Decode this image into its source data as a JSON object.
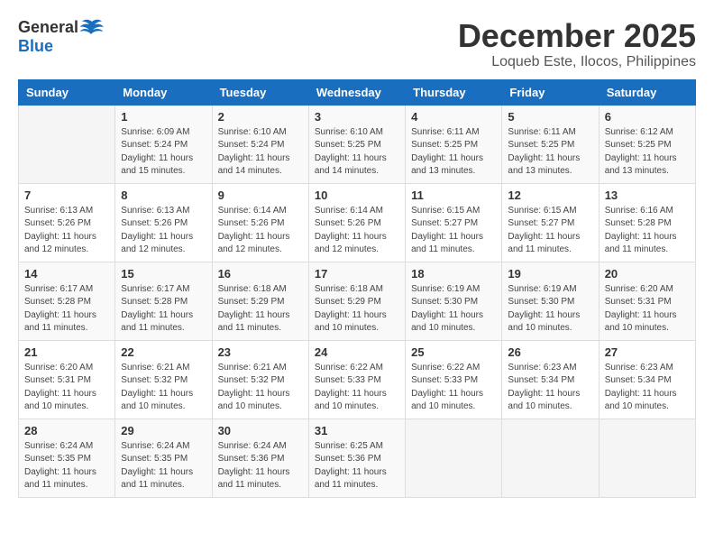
{
  "header": {
    "logo_general": "General",
    "logo_blue": "Blue",
    "month": "December 2025",
    "location": "Loqueb Este, Ilocos, Philippines"
  },
  "weekdays": [
    "Sunday",
    "Monday",
    "Tuesday",
    "Wednesday",
    "Thursday",
    "Friday",
    "Saturday"
  ],
  "weeks": [
    [
      {
        "day": "",
        "sunrise": "",
        "sunset": "",
        "daylight": ""
      },
      {
        "day": "1",
        "sunrise": "Sunrise: 6:09 AM",
        "sunset": "Sunset: 5:24 PM",
        "daylight": "Daylight: 11 hours and 15 minutes."
      },
      {
        "day": "2",
        "sunrise": "Sunrise: 6:10 AM",
        "sunset": "Sunset: 5:24 PM",
        "daylight": "Daylight: 11 hours and 14 minutes."
      },
      {
        "day": "3",
        "sunrise": "Sunrise: 6:10 AM",
        "sunset": "Sunset: 5:25 PM",
        "daylight": "Daylight: 11 hours and 14 minutes."
      },
      {
        "day": "4",
        "sunrise": "Sunrise: 6:11 AM",
        "sunset": "Sunset: 5:25 PM",
        "daylight": "Daylight: 11 hours and 13 minutes."
      },
      {
        "day": "5",
        "sunrise": "Sunrise: 6:11 AM",
        "sunset": "Sunset: 5:25 PM",
        "daylight": "Daylight: 11 hours and 13 minutes."
      },
      {
        "day": "6",
        "sunrise": "Sunrise: 6:12 AM",
        "sunset": "Sunset: 5:25 PM",
        "daylight": "Daylight: 11 hours and 13 minutes."
      }
    ],
    [
      {
        "day": "7",
        "sunrise": "Sunrise: 6:13 AM",
        "sunset": "Sunset: 5:26 PM",
        "daylight": "Daylight: 11 hours and 12 minutes."
      },
      {
        "day": "8",
        "sunrise": "Sunrise: 6:13 AM",
        "sunset": "Sunset: 5:26 PM",
        "daylight": "Daylight: 11 hours and 12 minutes."
      },
      {
        "day": "9",
        "sunrise": "Sunrise: 6:14 AM",
        "sunset": "Sunset: 5:26 PM",
        "daylight": "Daylight: 11 hours and 12 minutes."
      },
      {
        "day": "10",
        "sunrise": "Sunrise: 6:14 AM",
        "sunset": "Sunset: 5:26 PM",
        "daylight": "Daylight: 11 hours and 12 minutes."
      },
      {
        "day": "11",
        "sunrise": "Sunrise: 6:15 AM",
        "sunset": "Sunset: 5:27 PM",
        "daylight": "Daylight: 11 hours and 11 minutes."
      },
      {
        "day": "12",
        "sunrise": "Sunrise: 6:15 AM",
        "sunset": "Sunset: 5:27 PM",
        "daylight": "Daylight: 11 hours and 11 minutes."
      },
      {
        "day": "13",
        "sunrise": "Sunrise: 6:16 AM",
        "sunset": "Sunset: 5:28 PM",
        "daylight": "Daylight: 11 hours and 11 minutes."
      }
    ],
    [
      {
        "day": "14",
        "sunrise": "Sunrise: 6:17 AM",
        "sunset": "Sunset: 5:28 PM",
        "daylight": "Daylight: 11 hours and 11 minutes."
      },
      {
        "day": "15",
        "sunrise": "Sunrise: 6:17 AM",
        "sunset": "Sunset: 5:28 PM",
        "daylight": "Daylight: 11 hours and 11 minutes."
      },
      {
        "day": "16",
        "sunrise": "Sunrise: 6:18 AM",
        "sunset": "Sunset: 5:29 PM",
        "daylight": "Daylight: 11 hours and 11 minutes."
      },
      {
        "day": "17",
        "sunrise": "Sunrise: 6:18 AM",
        "sunset": "Sunset: 5:29 PM",
        "daylight": "Daylight: 11 hours and 10 minutes."
      },
      {
        "day": "18",
        "sunrise": "Sunrise: 6:19 AM",
        "sunset": "Sunset: 5:30 PM",
        "daylight": "Daylight: 11 hours and 10 minutes."
      },
      {
        "day": "19",
        "sunrise": "Sunrise: 6:19 AM",
        "sunset": "Sunset: 5:30 PM",
        "daylight": "Daylight: 11 hours and 10 minutes."
      },
      {
        "day": "20",
        "sunrise": "Sunrise: 6:20 AM",
        "sunset": "Sunset: 5:31 PM",
        "daylight": "Daylight: 11 hours and 10 minutes."
      }
    ],
    [
      {
        "day": "21",
        "sunrise": "Sunrise: 6:20 AM",
        "sunset": "Sunset: 5:31 PM",
        "daylight": "Daylight: 11 hours and 10 minutes."
      },
      {
        "day": "22",
        "sunrise": "Sunrise: 6:21 AM",
        "sunset": "Sunset: 5:32 PM",
        "daylight": "Daylight: 11 hours and 10 minutes."
      },
      {
        "day": "23",
        "sunrise": "Sunrise: 6:21 AM",
        "sunset": "Sunset: 5:32 PM",
        "daylight": "Daylight: 11 hours and 10 minutes."
      },
      {
        "day": "24",
        "sunrise": "Sunrise: 6:22 AM",
        "sunset": "Sunset: 5:33 PM",
        "daylight": "Daylight: 11 hours and 10 minutes."
      },
      {
        "day": "25",
        "sunrise": "Sunrise: 6:22 AM",
        "sunset": "Sunset: 5:33 PM",
        "daylight": "Daylight: 11 hours and 10 minutes."
      },
      {
        "day": "26",
        "sunrise": "Sunrise: 6:23 AM",
        "sunset": "Sunset: 5:34 PM",
        "daylight": "Daylight: 11 hours and 10 minutes."
      },
      {
        "day": "27",
        "sunrise": "Sunrise: 6:23 AM",
        "sunset": "Sunset: 5:34 PM",
        "daylight": "Daylight: 11 hours and 10 minutes."
      }
    ],
    [
      {
        "day": "28",
        "sunrise": "Sunrise: 6:24 AM",
        "sunset": "Sunset: 5:35 PM",
        "daylight": "Daylight: 11 hours and 11 minutes."
      },
      {
        "day": "29",
        "sunrise": "Sunrise: 6:24 AM",
        "sunset": "Sunset: 5:35 PM",
        "daylight": "Daylight: 11 hours and 11 minutes."
      },
      {
        "day": "30",
        "sunrise": "Sunrise: 6:24 AM",
        "sunset": "Sunset: 5:36 PM",
        "daylight": "Daylight: 11 hours and 11 minutes."
      },
      {
        "day": "31",
        "sunrise": "Sunrise: 6:25 AM",
        "sunset": "Sunset: 5:36 PM",
        "daylight": "Daylight: 11 hours and 11 minutes."
      },
      {
        "day": "",
        "sunrise": "",
        "sunset": "",
        "daylight": ""
      },
      {
        "day": "",
        "sunrise": "",
        "sunset": "",
        "daylight": ""
      },
      {
        "day": "",
        "sunrise": "",
        "sunset": "",
        "daylight": ""
      }
    ]
  ]
}
